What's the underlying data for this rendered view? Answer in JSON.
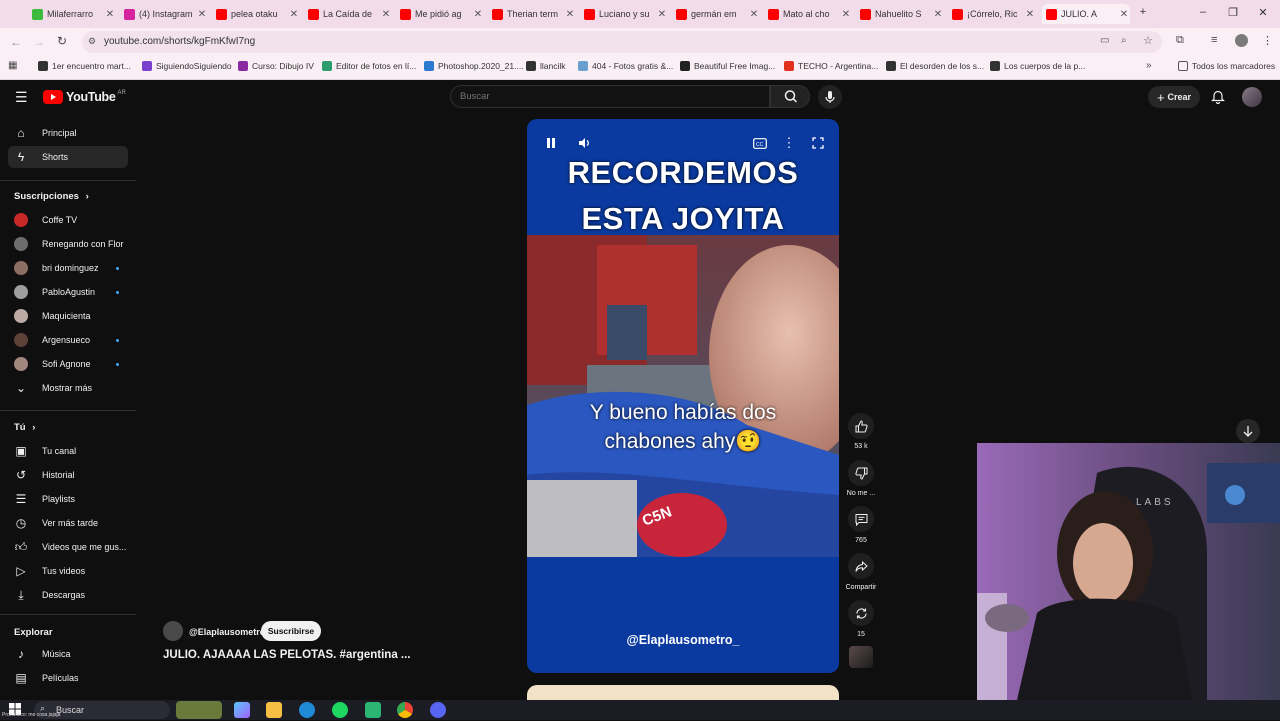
{
  "browser": {
    "tabs": [
      {
        "title": "Milaferrarro",
        "favicon_color": "#3dbb3d"
      },
      {
        "title": "(4) Instagram",
        "favicon_color": "#d6249f"
      },
      {
        "title": "pelea otaku",
        "favicon_color": "#ff0000"
      },
      {
        "title": "La Caída de",
        "favicon_color": "#ff0000"
      },
      {
        "title": "Me pidió ag",
        "favicon_color": "#ff0000"
      },
      {
        "title": "Therian term",
        "favicon_color": "#ff0000"
      },
      {
        "title": "Luciano y su",
        "favicon_color": "#ff0000"
      },
      {
        "title": "germán em",
        "favicon_color": "#ff0000"
      },
      {
        "title": "Mato al cho",
        "favicon_color": "#ff0000"
      },
      {
        "title": "Nahuelito S",
        "favicon_color": "#ff0000"
      },
      {
        "title": "¡Córrelo, Ric",
        "favicon_color": "#ff0000"
      },
      {
        "title": "JULIO. A",
        "favicon_color": "#ff0000"
      }
    ],
    "new_tab_label": "+",
    "url": "youtube.com/shorts/kgFmKfwI7ng",
    "bookmarks": [
      {
        "label": "1er encuentro mart...",
        "color": "#333333"
      },
      {
        "label": "SiguiendoSiguiendo",
        "color": "#7b3fd0"
      },
      {
        "label": "Curso: Dibujo IV",
        "color": "#8a2aa0"
      },
      {
        "label": "Editor de fotos en lí...",
        "color": "#2f9e6e"
      },
      {
        "label": "Photoshop.2020_21....",
        "color": "#2b7ad0"
      },
      {
        "label": "llancilk",
        "color": "#333333"
      },
      {
        "label": "404 - Fotos gratis &...",
        "color": "#6aa0d0"
      },
      {
        "label": "Beautiful Free Imag...",
        "color": "#222222"
      },
      {
        "label": "TECHO - Argentina...",
        "color": "#e0301e"
      },
      {
        "label": "El desorden de los s...",
        "color": "#333333"
      },
      {
        "label": "Los cuerpos de la p...",
        "color": "#333333"
      }
    ],
    "all_bookmarks_label": "Todos los marcadores"
  },
  "youtube": {
    "logo_text": "YouTube",
    "logo_region": "AR",
    "search_placeholder": "Buscar",
    "create_label": "Crear",
    "sidebar": {
      "main": [
        {
          "label": "Principal",
          "icon": "home-icon"
        },
        {
          "label": "Shorts",
          "icon": "shorts-icon",
          "active": true
        }
      ],
      "subscriptions_heading": "Suscripciones",
      "subscriptions": [
        {
          "label": "Coffe TV",
          "avatar_color": "#c62828",
          "live": false
        },
        {
          "label": "Renegando con Flor",
          "avatar_color": "#6d6d6d",
          "live": false
        },
        {
          "label": "bri dominguez",
          "avatar_color": "#8d6e63",
          "live": true
        },
        {
          "label": "PabloAgustin",
          "avatar_color": "#9e9e9e",
          "live": true
        },
        {
          "label": "Maquicienta",
          "avatar_color": "#bcaaa4",
          "live": false
        },
        {
          "label": "Argensueco",
          "avatar_color": "#5d4037",
          "live": true
        },
        {
          "label": "Sofi Agnone",
          "avatar_color": "#a1887f",
          "live": true
        }
      ],
      "show_more_label": "Mostrar más",
      "you_heading": "Tú",
      "you_items": [
        {
          "label": "Tu canal",
          "icon": "channel-icon"
        },
        {
          "label": "Historial",
          "icon": "history-icon"
        },
        {
          "label": "Playlists",
          "icon": "playlists-icon"
        },
        {
          "label": "Ver más tarde",
          "icon": "watch-later-icon"
        },
        {
          "label": "Videos que me gus...",
          "icon": "liked-icon"
        },
        {
          "label": "Tus videos",
          "icon": "your-videos-icon"
        },
        {
          "label": "Descargas",
          "icon": "downloads-icon"
        }
      ],
      "explore_heading": "Explorar",
      "explore_items": [
        {
          "label": "Música",
          "icon": "music-icon"
        },
        {
          "label": "Películas",
          "icon": "movies-icon"
        }
      ]
    },
    "short": {
      "caption_line1": "RECORDEMOS",
      "caption_line2": "ESTA JOYITA",
      "subtitle_line1": "Y bueno habías dos",
      "subtitle_line2": "chabones ahy🤨",
      "watermark": "@Elaplausometro_",
      "mic_brand": "C5N",
      "channel_handle": "@Elaplausometro",
      "subscribe_label": "Suscribirse",
      "title": "JULIO. AJAAAA LAS PELOTAS.  #argentina ...",
      "likes": "53 k",
      "dislike_label": "No me ...",
      "comments": "765",
      "share_label": "Compartir",
      "remix_count": "15"
    },
    "webcam_brand_text": "LABS"
  },
  "taskbar": {
    "search_label": "Buscar",
    "weather_text": "Pronóstico: me cosa jajaja"
  },
  "colors": {
    "yt_background": "#0f0f0f",
    "short_background": "#0a3aa0",
    "browser_chrome": "#fbeff6",
    "accent_red": "#ff0000"
  }
}
